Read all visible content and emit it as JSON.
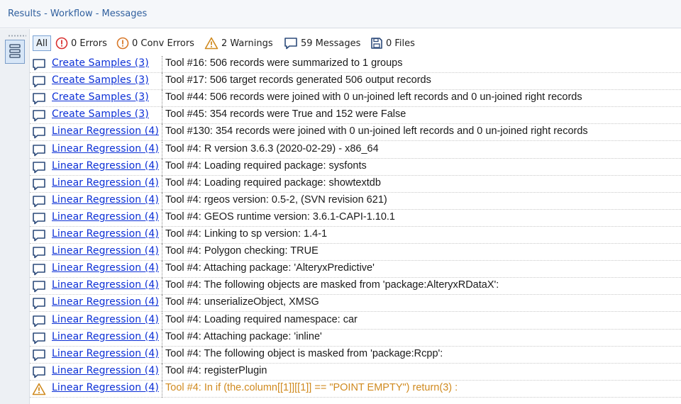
{
  "window": {
    "title": "Results - Workflow - Messages"
  },
  "toolbar": {
    "all": "All",
    "errors": "0 Errors",
    "conv_errors": "0 Conv Errors",
    "warnings": "2 Warnings",
    "messages": "59 Messages",
    "files": "0 Files"
  },
  "colors": {
    "link": "#0b2fd6",
    "warning": "#d08a1f",
    "error": "#d83030",
    "title": "#2f5f9e"
  },
  "rows": [
    {
      "icon": "message-icon",
      "tool": "Create Samples (3)",
      "message": "Tool #16: 506 records were summarized to 1 groups"
    },
    {
      "icon": "message-icon",
      "tool": "Create Samples (3)",
      "message": "Tool #17: 506 target records generated 506 output records"
    },
    {
      "icon": "message-icon",
      "tool": "Create Samples (3)",
      "message": "Tool #44: 506 records were joined with 0 un-joined left records and 0 un-joined right records"
    },
    {
      "icon": "message-icon",
      "tool": "Create Samples (3)",
      "message": "Tool #45: 354 records were True and 152 were False"
    },
    {
      "icon": "message-icon",
      "tool": "Linear Regression (4)",
      "message": "Tool #130: 354 records were joined with 0 un-joined left records and 0 un-joined right records"
    },
    {
      "icon": "message-icon",
      "tool": "Linear Regression (4)",
      "message": "Tool #4: R version 3.6.3 (2020-02-29) - x86_64"
    },
    {
      "icon": "message-icon",
      "tool": "Linear Regression (4)",
      "message": "Tool #4: Loading required package: sysfonts"
    },
    {
      "icon": "message-icon",
      "tool": "Linear Regression (4)",
      "message": "Tool #4: Loading required package: showtextdb"
    },
    {
      "icon": "message-icon",
      "tool": "Linear Regression (4)",
      "message": "Tool #4: rgeos version: 0.5-2, (SVN revision 621)"
    },
    {
      "icon": "message-icon",
      "tool": "Linear Regression (4)",
      "message": "Tool #4:  GEOS runtime version: 3.6.1-CAPI-1.10.1"
    },
    {
      "icon": "message-icon",
      "tool": "Linear Regression (4)",
      "message": "Tool #4:  Linking to sp version: 1.4-1"
    },
    {
      "icon": "message-icon",
      "tool": "Linear Regression (4)",
      "message": "Tool #4:  Polygon checking: TRUE"
    },
    {
      "icon": "message-icon",
      "tool": "Linear Regression (4)",
      "message": "Tool #4: Attaching package: 'AlteryxPredictive'"
    },
    {
      "icon": "message-icon",
      "tool": "Linear Regression (4)",
      "message": "Tool #4: The following objects are masked from 'package:AlteryxRDataX':"
    },
    {
      "icon": "message-icon",
      "tool": "Linear Regression (4)",
      "message": "Tool #4:     unserializeObject, XMSG"
    },
    {
      "icon": "message-icon",
      "tool": "Linear Regression (4)",
      "message": "Tool #4: Loading required namespace: car"
    },
    {
      "icon": "message-icon",
      "tool": "Linear Regression (4)",
      "message": "Tool #4: Attaching package: 'inline'"
    },
    {
      "icon": "message-icon",
      "tool": "Linear Regression (4)",
      "message": "Tool #4: The following object is masked from 'package:Rcpp':"
    },
    {
      "icon": "message-icon",
      "tool": "Linear Regression (4)",
      "message": "Tool #4:     registerPlugin"
    },
    {
      "icon": "warning-icon",
      "tool": "Linear Regression (4)",
      "message": "Tool #4: In if (the.column[[1]][[1]] == \"POINT EMPTY\") return(3) :"
    }
  ]
}
